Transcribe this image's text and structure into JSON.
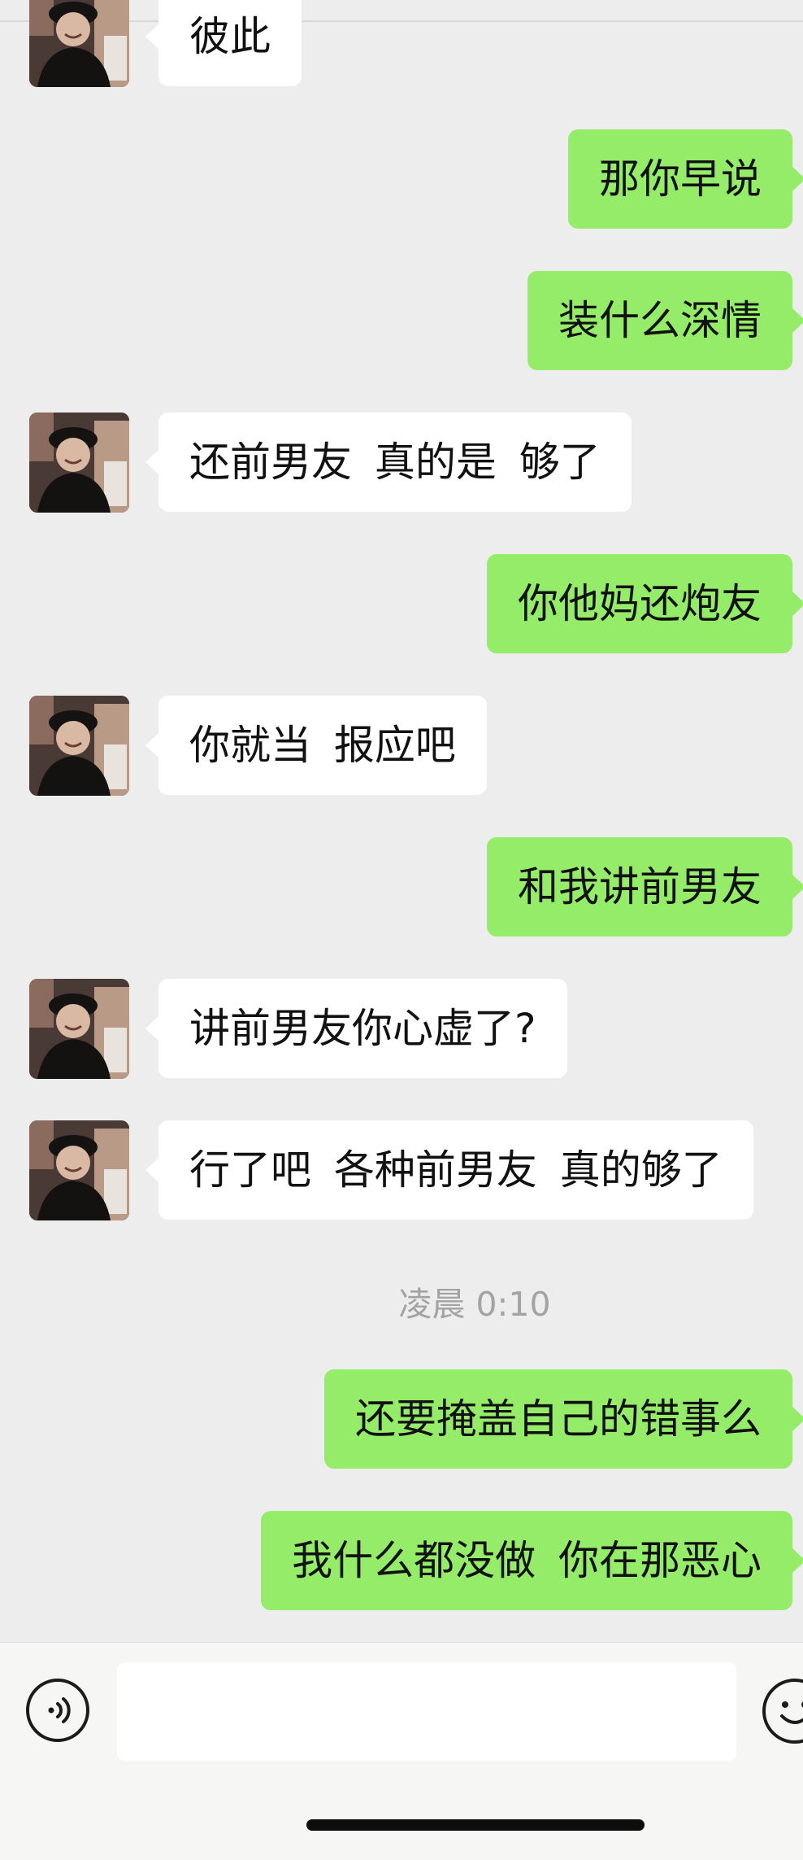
{
  "chat": {
    "messages": [
      {
        "id": "m1",
        "direction": "incoming",
        "text": "彼此"
      },
      {
        "id": "m2",
        "direction": "outgoing",
        "text": "那你早说"
      },
      {
        "id": "m3",
        "direction": "outgoing",
        "text": "装什么深情"
      },
      {
        "id": "m4",
        "direction": "incoming",
        "text": "还前男友 真的是 够了"
      },
      {
        "id": "m5",
        "direction": "outgoing",
        "text": "你他妈还炮友"
      },
      {
        "id": "m6",
        "direction": "incoming",
        "text": "你就当 报应吧"
      },
      {
        "id": "m7",
        "direction": "outgoing",
        "text": "和我讲前男友"
      },
      {
        "id": "m8",
        "direction": "incoming",
        "text": "讲前男友你心虚了?"
      },
      {
        "id": "m9",
        "direction": "incoming",
        "text": "行了吧  各种前男友 真的够了"
      },
      {
        "id": "m10",
        "direction": "outgoing",
        "text": "还要掩盖自己的错事么"
      },
      {
        "id": "m11",
        "direction": "outgoing",
        "text": "我什么都没做 你在那恶心"
      }
    ],
    "timestamp": "凌晨 0:10"
  },
  "input_bar": {
    "voice_icon": "voice-icon",
    "emoji_icon": "emoji-icon",
    "message_value": ""
  },
  "colors": {
    "background": "#ededed",
    "incoming_bubble": "#ffffff",
    "outgoing_bubble": "#95ec69",
    "timestamp_text": "#a3a3a3"
  }
}
